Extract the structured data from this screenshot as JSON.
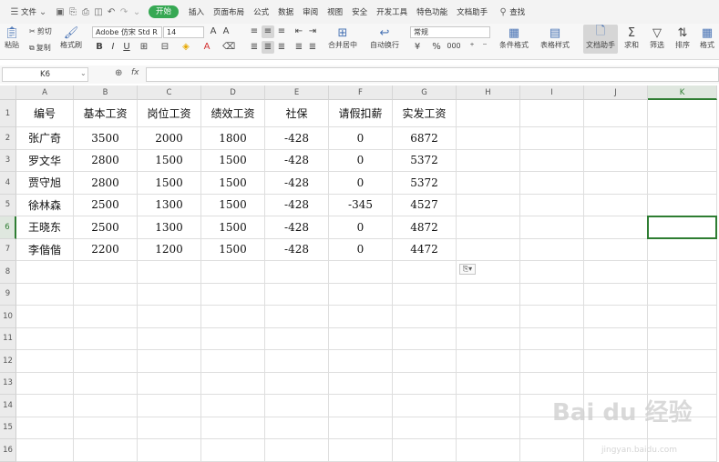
{
  "menubar": {
    "file_label": "文件",
    "tabs": [
      "开始",
      "插入",
      "页面布局",
      "公式",
      "数据",
      "审阅",
      "视图",
      "安全",
      "开发工具",
      "特色功能",
      "文档助手"
    ],
    "search_label": "查找"
  },
  "ribbon": {
    "paste": "粘贴",
    "cut": "剪切",
    "copy": "复制",
    "format_painter": "格式刷",
    "font_name": "Adobe 仿宋 Std R",
    "font_size": "14",
    "bold": "B",
    "italic": "I",
    "underline": "U",
    "merge_center": "合并居中",
    "auto_wrap": "自动换行",
    "number_format": "常规",
    "percent": "%",
    "thousands": "000",
    "cond_format": "条件格式",
    "table_style": "表格样式",
    "doc_assistant": "文档助手",
    "sum": "求和",
    "filter": "筛选",
    "sort": "排序",
    "format": "格式"
  },
  "formula_bar": {
    "cell_ref": "K6",
    "fx": "fx",
    "value": ""
  },
  "sheet": {
    "columns": [
      "A",
      "B",
      "C",
      "D",
      "E",
      "F",
      "G",
      "H",
      "I",
      "J",
      "K"
    ],
    "row_numbers": [
      "1",
      "2",
      "3",
      "4",
      "5",
      "6",
      "7",
      "8",
      "9",
      "10",
      "11",
      "12",
      "13",
      "14",
      "15",
      "16"
    ],
    "header": [
      "编号",
      "基本工资",
      "岗位工资",
      "绩效工资",
      "社保",
      "请假扣薪",
      "实发工资"
    ],
    "rows": [
      [
        "张广奇",
        "3500",
        "2000",
        "1800",
        "-428",
        "0",
        "6872"
      ],
      [
        "罗文华",
        "2800",
        "1500",
        "1500",
        "-428",
        "0",
        "5372"
      ],
      [
        "贾守旭",
        "2800",
        "1500",
        "1500",
        "-428",
        "0",
        "5372"
      ],
      [
        "徐林森",
        "2500",
        "1300",
        "1500",
        "-428",
        "-345",
        "4527"
      ],
      [
        "王晓东",
        "2500",
        "1300",
        "1500",
        "-428",
        "0",
        "4872"
      ],
      [
        "李偕偕",
        "2200",
        "1200",
        "1500",
        "-428",
        "0",
        "4472"
      ]
    ],
    "selected_cell": "K6"
  },
  "watermark": {
    "brand": "Bai du 经验",
    "url": "jingyan.baidu.com"
  }
}
